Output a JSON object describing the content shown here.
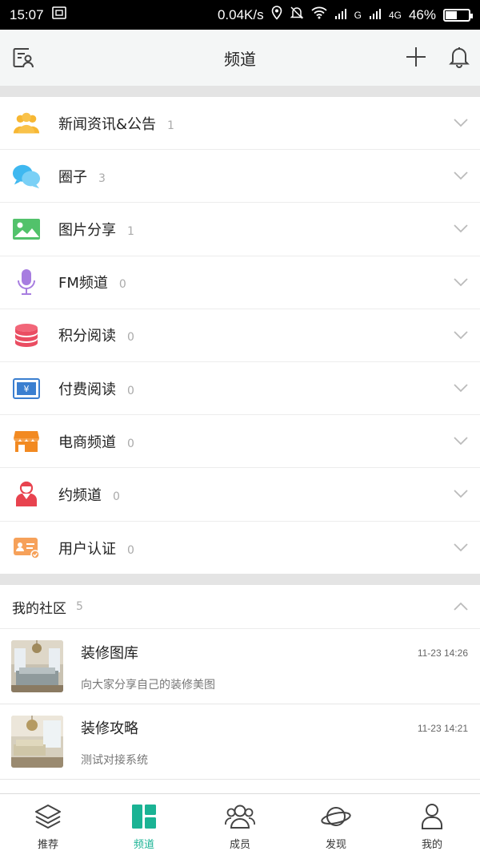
{
  "status_bar": {
    "time": "15:07",
    "speed": "0.04K/s",
    "network1": "G",
    "network2": "4G",
    "battery": "46%",
    "battery_level": 0.46
  },
  "header": {
    "title": "频道",
    "left_icon": "contacts-icon",
    "add_icon": "plus-icon",
    "notify_icon": "bell-icon"
  },
  "channels": [
    {
      "label": "新闻资讯&公告",
      "count": "1",
      "icon": "people-icon",
      "color": "#f7b733"
    },
    {
      "label": "圈子",
      "count": "3",
      "icon": "chat-bubbles-icon",
      "color": "#3fb8f0"
    },
    {
      "label": "图片分享",
      "count": "1",
      "icon": "image-icon",
      "color": "#52c26b"
    },
    {
      "label": "FM频道",
      "count": "0",
      "icon": "microphone-icon",
      "color": "#a77de0"
    },
    {
      "label": "积分阅读",
      "count": "0",
      "icon": "coin-stack-icon",
      "color": "#ea4d62"
    },
    {
      "label": "付费阅读",
      "count": "0",
      "icon": "yuan-card-icon",
      "color": "#3b7fd0"
    },
    {
      "label": "电商频道",
      "count": "0",
      "icon": "shop-icon",
      "color": "#f28a22"
    },
    {
      "label": "约频道",
      "count": "0",
      "icon": "person-dating-icon",
      "color": "#e8434f"
    },
    {
      "label": "用户认证",
      "count": "0",
      "icon": "id-card-icon",
      "color": "#f6a15a"
    }
  ],
  "community": {
    "label": "我的社区",
    "count": "5",
    "items": [
      {
        "name": "装修图库",
        "desc": "向大家分享自己的装修美图",
        "time": "11-23 14:26"
      },
      {
        "name": "装修攻略",
        "desc": "测试对接系统",
        "time": "11-23 14:21"
      }
    ]
  },
  "tabs": [
    {
      "label": "推荐",
      "icon": "layers-icon",
      "active": false
    },
    {
      "label": "频道",
      "icon": "grid-icon",
      "active": true
    },
    {
      "label": "成员",
      "icon": "members-icon",
      "active": false
    },
    {
      "label": "发现",
      "icon": "planet-icon",
      "active": false
    },
    {
      "label": "我的",
      "icon": "profile-icon",
      "active": false
    }
  ],
  "colors": {
    "accent": "#1ab394",
    "divider": "#e4e4e4"
  }
}
